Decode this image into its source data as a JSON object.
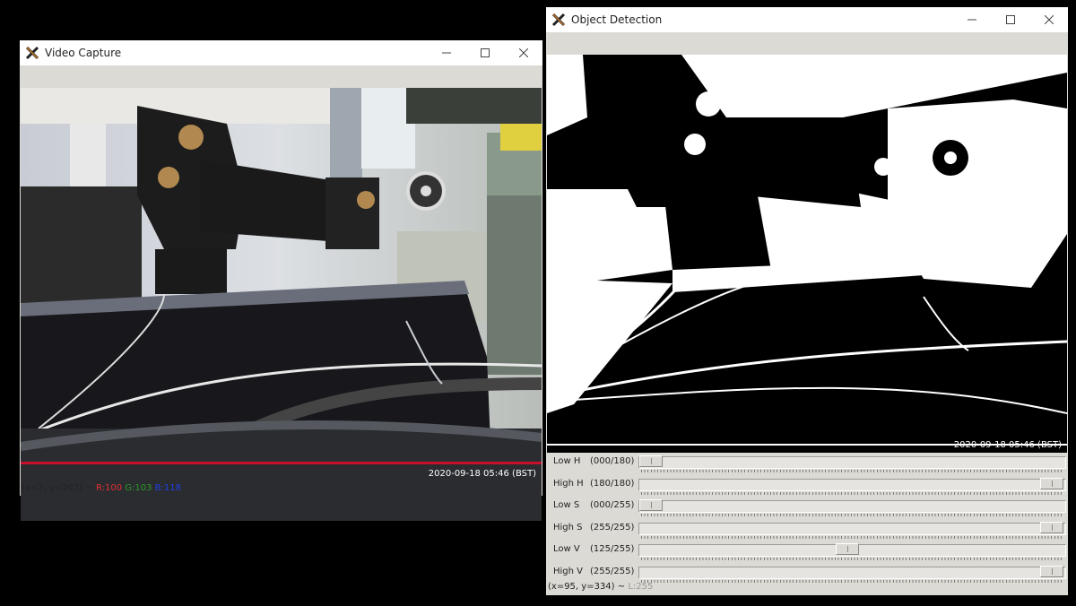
{
  "video_window": {
    "title": "Video Capture",
    "timestamp": "2020-09-18 05:46 (BST)",
    "status": {
      "coords": "(x=7, y=207) ~",
      "r": "R:100",
      "g": "G:103",
      "b": "B:118"
    },
    "colors": {
      "r": "#e03030",
      "g": "#2a9a2a",
      "b": "#2040e0"
    }
  },
  "detection_window": {
    "title": "Object Detection",
    "timestamp": "2020-09-18 05:46 (BST)",
    "status": {
      "coords": "(x=95, y=334) ~",
      "l": "L:255"
    },
    "trackbars": [
      {
        "label": "Low H",
        "value": "(000/180)",
        "level": 0.0
      },
      {
        "label": "High H",
        "value": "(180/180)",
        "level": 1.0
      },
      {
        "label": "Low S",
        "value": "(000/255)",
        "level": 0.0
      },
      {
        "label": "High S",
        "value": "(255/255)",
        "level": 1.0
      },
      {
        "label": "Low V",
        "value": "(125/255)",
        "level": 0.49
      },
      {
        "label": "High V",
        "value": "(255/255)",
        "level": 1.0
      }
    ]
  },
  "window_controls": {
    "minimize": "—",
    "maximize": "☐",
    "close": "✕"
  }
}
